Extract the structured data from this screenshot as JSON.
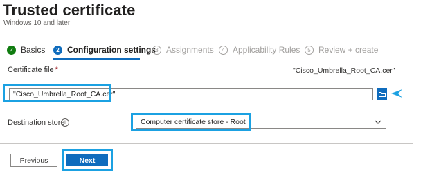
{
  "header": {
    "title": "Trusted certificate",
    "more_label": "···",
    "subtitle": "Windows 10 and later"
  },
  "steps": [
    {
      "badge": "✓",
      "label": "Basics",
      "state": "done"
    },
    {
      "badge": "2",
      "label": "Configuration settings",
      "state": "active"
    },
    {
      "badge": "3",
      "label": "Assignments",
      "state": "inactive"
    },
    {
      "badge": "4",
      "label": "Applicability Rules",
      "state": "inactive"
    },
    {
      "badge": "5",
      "label": "Review + create",
      "state": "inactive"
    }
  ],
  "certificate_file": {
    "label": "Certificate file",
    "required_mark": "*",
    "selected_name": "\"Cisco_Umbrella_Root_CA.cer\"",
    "input_value": "\"Cisco_Umbrella_Root_CA.cer\"",
    "browse_icon": "folder-icon"
  },
  "destination_store": {
    "label": "Destination store",
    "info_icon": "info-icon",
    "info_glyph": "i",
    "selected_value": "Computer certificate store - Root"
  },
  "footer": {
    "previous_label": "Previous",
    "next_label": "Next"
  },
  "colors": {
    "accent": "#0f6cbd",
    "success": "#107c10",
    "highlight": "#1ba1e2",
    "required": "#a4262c"
  }
}
